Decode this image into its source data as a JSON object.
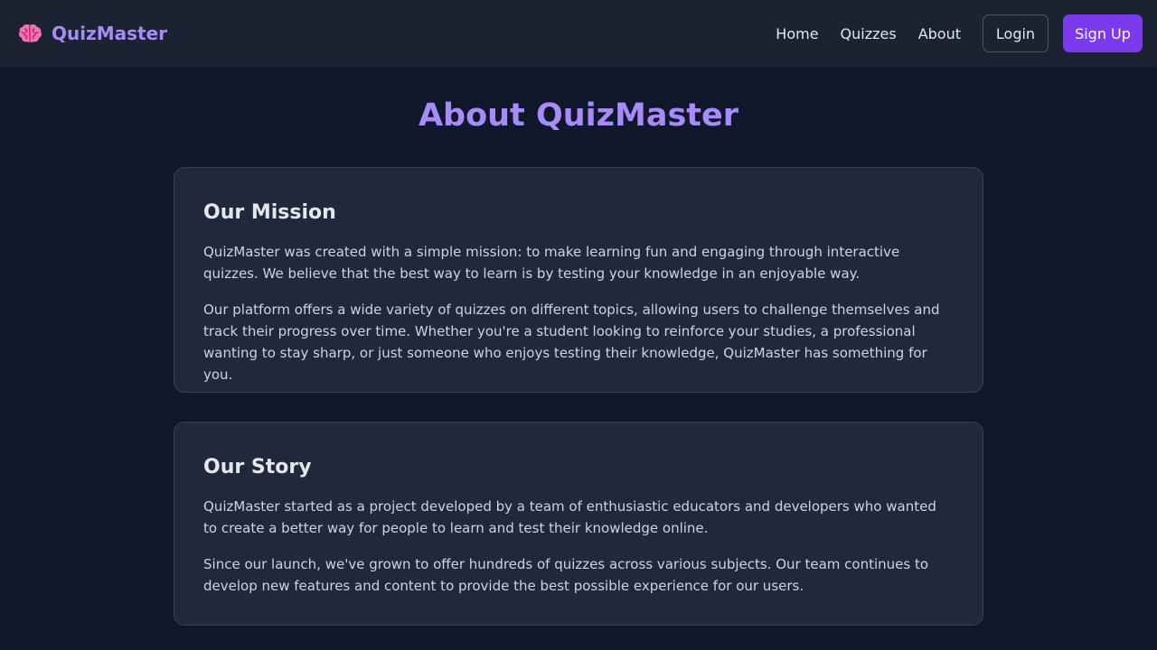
{
  "brand": {
    "icon": "brain-icon",
    "name": "QuizMaster"
  },
  "nav": {
    "links": [
      "Home",
      "Quizzes",
      "About"
    ],
    "login_label": "Login",
    "signup_label": "Sign Up"
  },
  "colors": {
    "accent": "#a78bfa",
    "primary_button": "#7c3aed",
    "background": "#0f172a",
    "navbar": "#1b2232",
    "card": "#1f293b"
  },
  "page": {
    "title": "About QuizMaster"
  },
  "sections": [
    {
      "heading": "Our Mission",
      "paragraphs": [
        "QuizMaster was created with a simple mission: to make learning fun and engaging through interactive quizzes. We believe that the best way to learn is by testing your knowledge in an enjoyable way.",
        "Our platform offers a wide variety of quizzes on different topics, allowing users to challenge themselves and track their progress over time. Whether you're a student looking to reinforce your studies, a professional wanting to stay sharp, or just someone who enjoys testing their knowledge, QuizMaster has something for you."
      ]
    },
    {
      "heading": "Our Story",
      "paragraphs": [
        "QuizMaster started as a project developed by a team of enthusiastic educators and developers who wanted to create a better way for people to learn and test their knowledge online.",
        "Since our launch, we've grown to offer hundreds of quizzes across various subjects. Our team continues to develop new features and content to provide the best possible experience for our users."
      ]
    }
  ]
}
